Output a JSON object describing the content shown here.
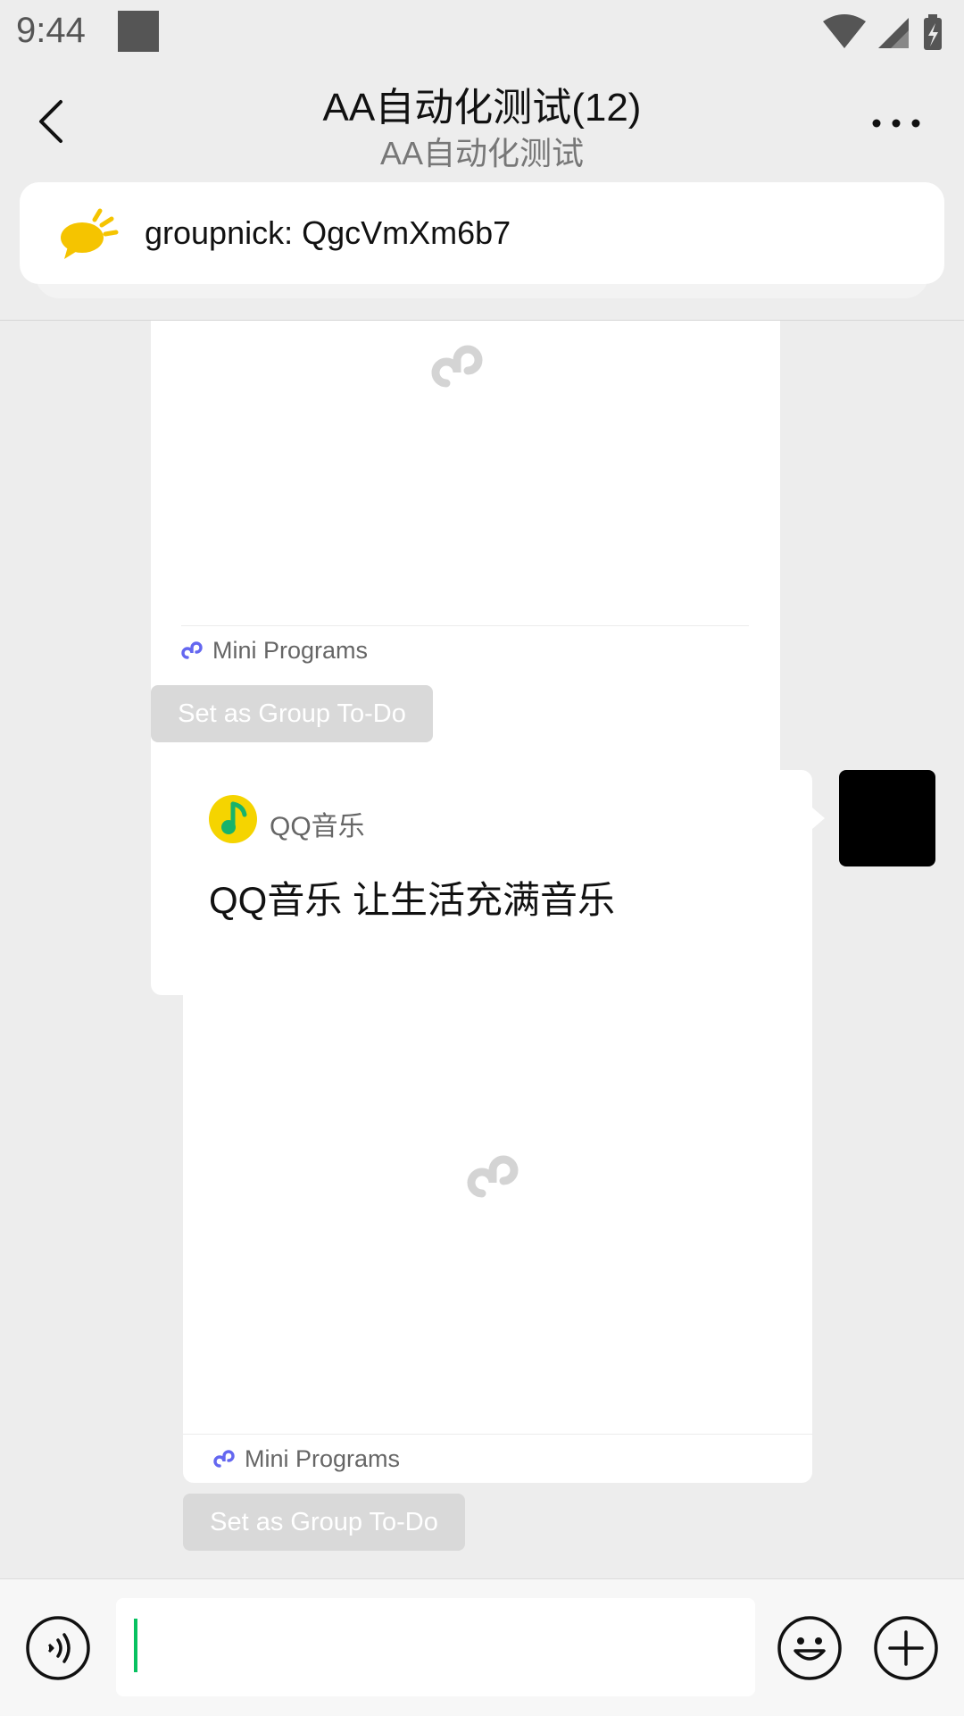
{
  "status_bar": {
    "time": "9:44"
  },
  "header": {
    "title": "AA自动化测试(12)",
    "subtitle": "AA自动化测试"
  },
  "notice": {
    "text": "groupnick: QgcVmXm6b7"
  },
  "messages": [
    {
      "type": "mini_program",
      "footer_label": "Mini Programs",
      "todo_label": "Set as Group To-Do"
    },
    {
      "type": "mini_program",
      "app_name": "QQ音乐",
      "title": "QQ音乐 让生活充满音乐",
      "footer_label": "Mini Programs",
      "todo_label": "Set as Group To-Do"
    }
  ],
  "colors": {
    "background": "#ededed",
    "accent_green": "#07c160",
    "notice_icon": "#f5c400",
    "mini_program_icon": "#6467f0"
  },
  "icons": {
    "back": "back-arrow-icon",
    "more": "more-dots-icon",
    "notice": "announcement-icon",
    "voice": "voice-icon",
    "emoji": "emoji-icon",
    "plus": "plus-icon"
  }
}
